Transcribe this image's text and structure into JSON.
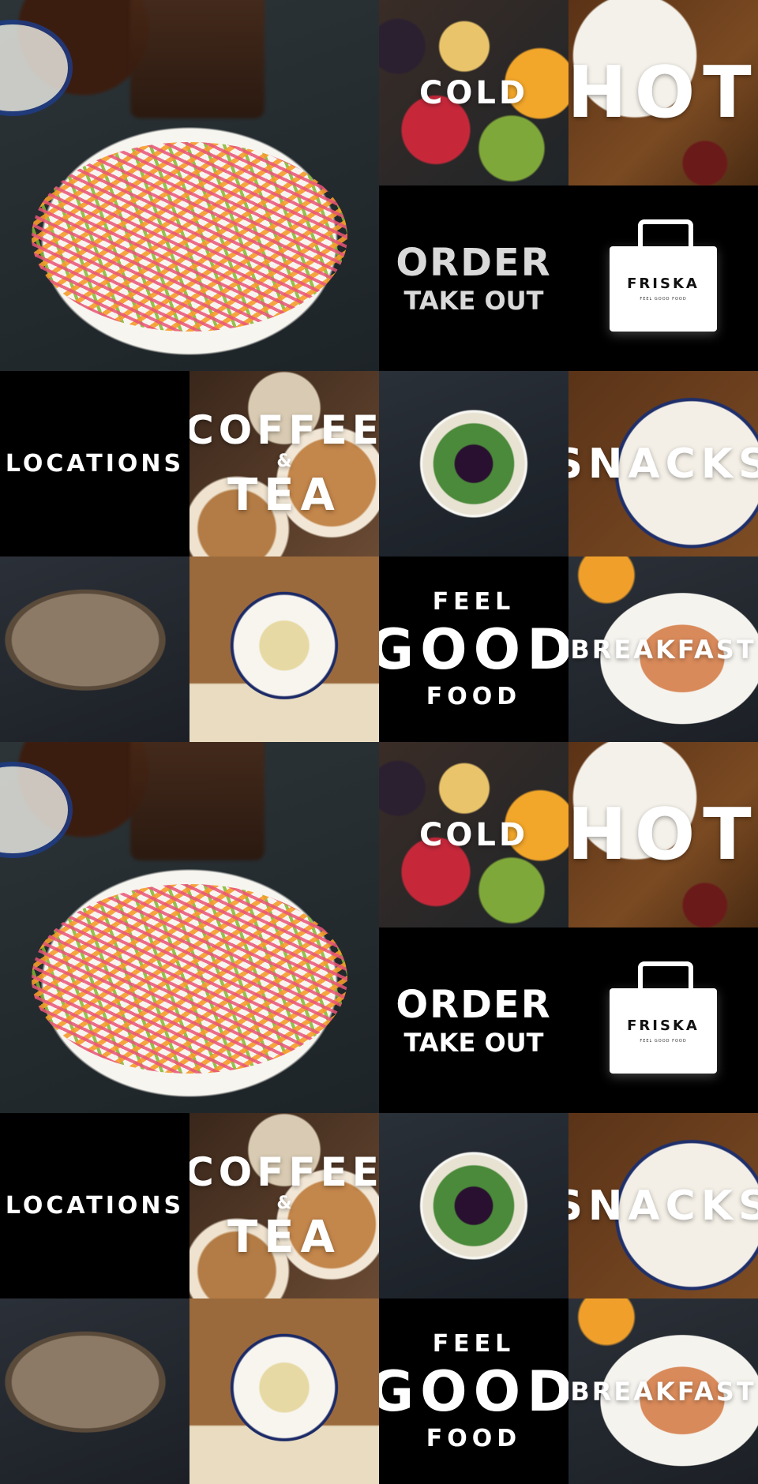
{
  "tiles": {
    "cold": "COLD",
    "hot": "HOT",
    "order_line1": "ORDER",
    "order_line2": "TAKE OUT",
    "bag_brand": "FRISKA",
    "bag_tagline": "FEEL GOOD FOOD",
    "locations": "LOCATIONS",
    "coffee": "COFFEE",
    "amp": "&",
    "tea": "TEA",
    "snacks": "SNACKS",
    "feel": "FEEL",
    "good": "GOOD",
    "food": "FOOD",
    "breakfast": "BREAKFAST"
  },
  "colors": {
    "text": "#ffffff",
    "tile_black": "#000000",
    "bag": "#ffffff",
    "order_text": "#d9d9d9"
  }
}
